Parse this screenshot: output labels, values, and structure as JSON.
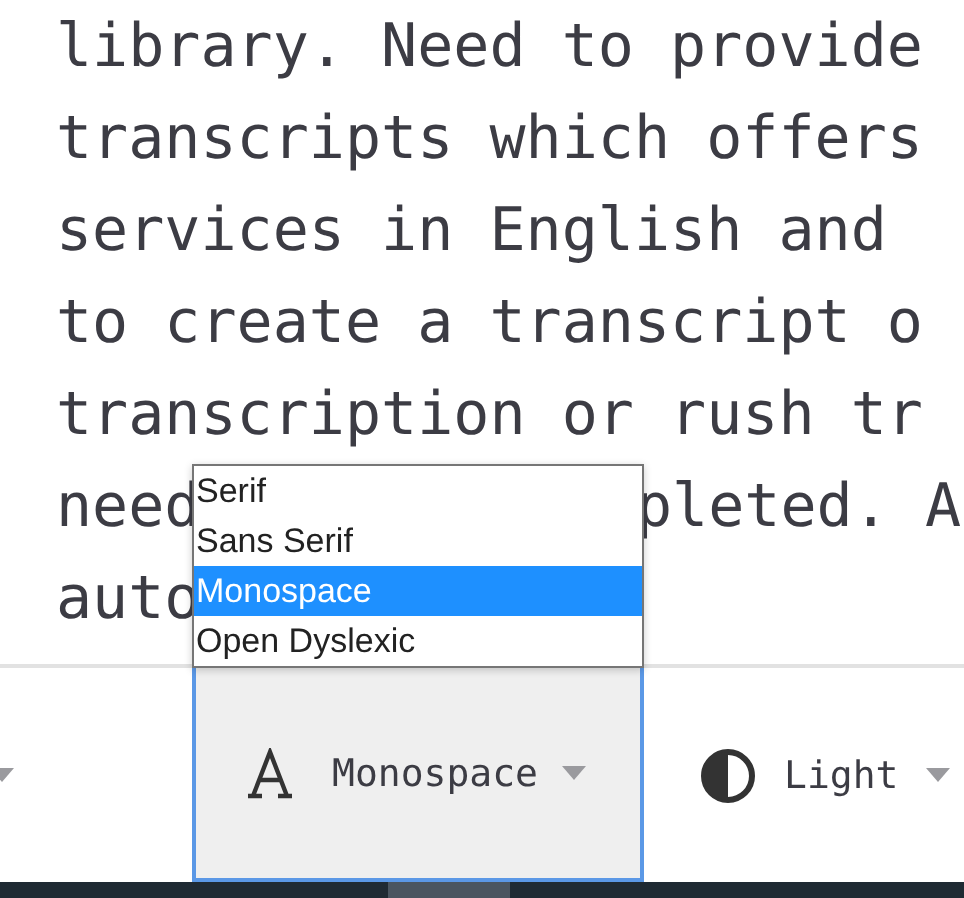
{
  "text_lines": [
    {
      "segments": [
        "library. Need to provide"
      ]
    },
    {
      "segments": [
        "transcripts which offers"
      ]
    },
    {
      "segments": [
        "services in English and"
      ]
    },
    {
      "segments": [
        "to create a transcript o"
      ]
    },
    {
      "segments": [
        "transcription or rush tr"
      ]
    },
    {
      "segments": [
        "need",
        "pleted. A"
      ]
    },
    {
      "segments": [
        "auto"
      ]
    }
  ],
  "toolbar": {
    "font_select": {
      "value": "Monospace",
      "expanded": true,
      "options": [
        {
          "label": "Serif",
          "selected": false
        },
        {
          "label": "Sans Serif",
          "selected": false
        },
        {
          "label": "Monospace",
          "selected": true
        },
        {
          "label": "Open Dyslexic",
          "selected": false
        }
      ]
    },
    "theme_select": {
      "value": "Light"
    }
  }
}
